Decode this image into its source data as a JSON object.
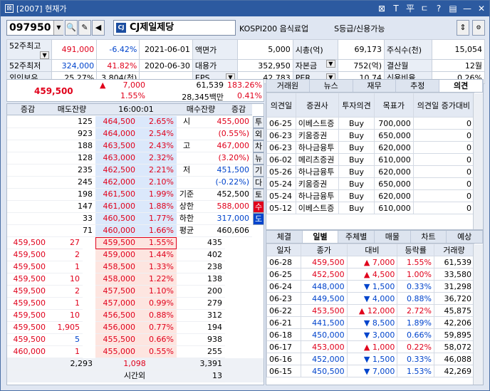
{
  "window": {
    "title": "[2007] 현재가",
    "buttons": [
      "⊠",
      "T",
      "平",
      "ㄷ",
      "?",
      "▤",
      "—",
      "✕"
    ]
  },
  "header": {
    "code": "097950",
    "name": "CJ제일제당",
    "group": "KOSPI200  음식료업",
    "grade": "S등급/신용가능"
  },
  "info": {
    "rows": [
      [
        {
          "t": "52주최고",
          "lab": true,
          "dd": true
        },
        {
          "t": "491,000",
          "c": "red"
        },
        {
          "t": "-6.42%",
          "c": "blue"
        },
        {
          "t": "2021-06-01"
        },
        {
          "t": "액면가",
          "lab": true
        },
        {
          "t": "5,000"
        },
        {
          "t": "시총(억)",
          "lab": true
        },
        {
          "t": "69,173"
        },
        {
          "t": "주식수(천)",
          "lab": true
        },
        {
          "t": "15,054"
        }
      ],
      [
        {
          "t": "52주최저",
          "lab": true
        },
        {
          "t": "324,000",
          "c": "blue"
        },
        {
          "t": "41.82%",
          "c": "red"
        },
        {
          "t": "2020-06-30"
        },
        {
          "t": "대용가",
          "lab": true
        },
        {
          "t": "352,950"
        },
        {
          "t": "자본금",
          "lab": true,
          "dd": true
        },
        {
          "t": "752(억)"
        },
        {
          "t": "결산월",
          "lab": true
        },
        {
          "t": "12월"
        }
      ],
      [
        {
          "t": "외인보유",
          "lab": true
        },
        {
          "t": "25.27%"
        },
        {
          "t": "3,804(천)"
        },
        {
          "t": ""
        },
        {
          "t": "EPS",
          "lab": true,
          "dd": true
        },
        {
          "t": "42,783"
        },
        {
          "t": "PER",
          "lab": true,
          "dd": true
        },
        {
          "t": "10.74"
        },
        {
          "t": "신용비율",
          "lab": true
        },
        {
          "t": "0.26%"
        }
      ]
    ]
  },
  "summary": {
    "price": "459,500",
    "arrow": "▲",
    "change": "7,000",
    "change_pct": "1.55%",
    "volume": "61,539",
    "volume_pct": "183.26%",
    "amount": "28,345백만",
    "amount_pct": "0.41%"
  },
  "orderbook": {
    "headers": {
      "chk": "증감",
      "ask_rem": "매도잔량",
      "time": "16:00:01",
      "bid_rem": "매수잔량",
      "chk2": "증감"
    },
    "asks": [
      {
        "q": "125",
        "p": "464,500",
        "r": "2.65%"
      },
      {
        "q": "923",
        "p": "464,000",
        "r": "2.54%"
      },
      {
        "q": "188",
        "p": "463,500",
        "r": "2.43%"
      },
      {
        "q": "128",
        "p": "463,000",
        "r": "2.32%"
      },
      {
        "q": "235",
        "p": "462,500",
        "r": "2.21%"
      },
      {
        "q": "245",
        "p": "462,000",
        "r": "2.10%"
      },
      {
        "q": "198",
        "p": "461,500",
        "r": "1.99%"
      },
      {
        "q": "147",
        "p": "461,000",
        "r": "1.88%"
      },
      {
        "q": "33",
        "p": "460,500",
        "r": "1.77%"
      },
      {
        "q": "71",
        "p": "460,000",
        "r": "1.66%"
      }
    ],
    "bids": [
      {
        "p": "459,500",
        "r": "1.55%",
        "q": "435"
      },
      {
        "p": "459,000",
        "r": "1.44%",
        "q": "402"
      },
      {
        "p": "458,500",
        "r": "1.33%",
        "q": "238"
      },
      {
        "p": "458,000",
        "r": "1.22%",
        "q": "138"
      },
      {
        "p": "457,500",
        "r": "1.10%",
        "q": "200"
      },
      {
        "p": "457,000",
        "r": "0.99%",
        "q": "279"
      },
      {
        "p": "456,500",
        "r": "0.88%",
        "q": "312"
      },
      {
        "p": "456,000",
        "r": "0.77%",
        "q": "194"
      },
      {
        "p": "455,500",
        "r": "0.66%",
        "q": "938"
      },
      {
        "p": "455,000",
        "r": "0.55%",
        "q": "255"
      }
    ],
    "trades": [
      {
        "p": "459,500",
        "v": "27"
      },
      {
        "p": "459,500",
        "v": "2"
      },
      {
        "p": "459,500",
        "v": "1"
      },
      {
        "p": "459,500",
        "v": "10"
      },
      {
        "p": "459,500",
        "v": "2"
      },
      {
        "p": "459,500",
        "v": "1"
      },
      {
        "p": "459,500",
        "v": "10"
      },
      {
        "p": "459,500",
        "v": "1,905"
      },
      {
        "p": "459,500",
        "v": "5"
      },
      {
        "p": "460,000",
        "v": "1"
      }
    ],
    "stats": [
      {
        "k": "시",
        "v": "455,000",
        "c": "red"
      },
      {
        "k": "",
        "v": "(0.55%)",
        "c": "red"
      },
      {
        "k": "고",
        "v": "467,000",
        "c": "red"
      },
      {
        "k": "",
        "v": "(3.20%)",
        "c": "red"
      },
      {
        "k": "저",
        "v": "451,500",
        "c": "blue"
      },
      {
        "k": "",
        "v": "(-0.22%)",
        "c": "blue"
      },
      {
        "k": "기준",
        "v": "452,500",
        "c": ""
      },
      {
        "k": "상한",
        "v": "588,000",
        "c": "red"
      },
      {
        "k": "하한",
        "v": "317,000",
        "c": "blue"
      },
      {
        "k": "평균",
        "v": "460,606",
        "c": ""
      }
    ],
    "side_tabs": [
      "투",
      "외",
      "차",
      "뉴",
      "기",
      "다",
      "토",
      "수",
      "도"
    ],
    "totals": {
      "ask": "2,293",
      "diff": "1,098",
      "bid": "3,391",
      "after_label": "시간외",
      "after_val": "13"
    }
  },
  "opinion": {
    "tabs": [
      "거래원",
      "뉴스",
      "재무",
      "추정",
      "의견"
    ],
    "headers": [
      "의견일",
      "증권사",
      "투자의견",
      "목표가",
      "의견일 증가대비"
    ],
    "rows": [
      [
        "06-25",
        "이베스트증",
        "Buy",
        "700,000",
        "0"
      ],
      [
        "06-23",
        "키움증권",
        "Buy",
        "650,000",
        "0"
      ],
      [
        "06-23",
        "하나금융투",
        "Buy",
        "620,000",
        "0"
      ],
      [
        "06-02",
        "메리츠증권",
        "Buy",
        "610,000",
        "0"
      ],
      [
        "05-26",
        "하나금융투",
        "Buy",
        "620,000",
        "0"
      ],
      [
        "05-24",
        "키움증권",
        "Buy",
        "650,000",
        "0"
      ],
      [
        "05-24",
        "하나금융투",
        "Buy",
        "620,000",
        "0"
      ],
      [
        "05-12",
        "이베스트증",
        "Buy",
        "610,000",
        "0"
      ]
    ]
  },
  "daily": {
    "tabs": [
      "체결",
      "일별",
      "주체별",
      "매물",
      "차트",
      "예상"
    ],
    "headers": [
      "일자",
      "종가",
      "대비",
      "등락률",
      "거래량"
    ],
    "rows": [
      [
        "06-28",
        "459,500",
        "up",
        "7,000",
        "1.55%",
        "61,539"
      ],
      [
        "06-25",
        "452,500",
        "up",
        "4,500",
        "1.00%",
        "33,580"
      ],
      [
        "06-24",
        "448,000",
        "dn",
        "1,500",
        "0.33%",
        "31,298"
      ],
      [
        "06-23",
        "449,500",
        "dn",
        "4,000",
        "0.88%",
        "36,720"
      ],
      [
        "06-22",
        "453,500",
        "up",
        "12,000",
        "2.72%",
        "45,875"
      ],
      [
        "06-21",
        "441,500",
        "dn",
        "8,500",
        "1.89%",
        "42,206"
      ],
      [
        "06-18",
        "450,000",
        "dn",
        "3,000",
        "0.66%",
        "59,895"
      ],
      [
        "06-17",
        "453,000",
        "up",
        "1,000",
        "0.22%",
        "58,072"
      ],
      [
        "06-16",
        "452,000",
        "dn",
        "1,500",
        "0.33%",
        "46,088"
      ],
      [
        "06-15",
        "450,500",
        "dn",
        "7,000",
        "1.53%",
        "42,269"
      ]
    ]
  },
  "colors": {
    "up": "#e0001b",
    "down": "#0044cc",
    "ask_bg": "#dbe8fb",
    "bid_bg": "#fde5e0",
    "title": "#2c5aa0"
  }
}
